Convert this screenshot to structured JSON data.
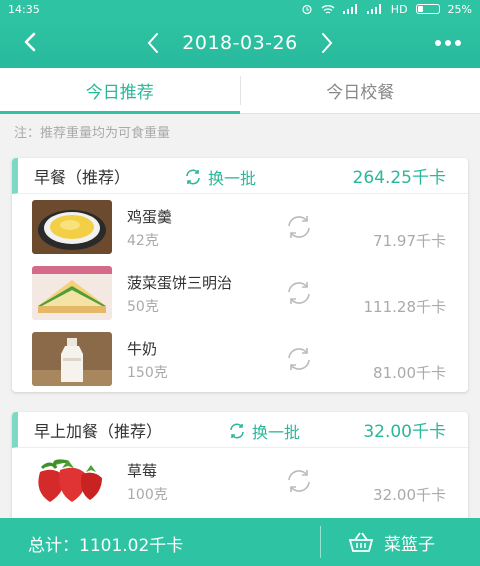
{
  "status_bar": {
    "time": "14:35",
    "network": "HD",
    "battery": "25%"
  },
  "header": {
    "date": "2018-03-26"
  },
  "tabs": [
    {
      "label": "今日推荐",
      "active": true
    },
    {
      "label": "今日校餐",
      "active": false
    }
  ],
  "note": "注：推荐重量均为可食重量",
  "meals": [
    {
      "title": "早餐（推荐）",
      "refresh_label": "换一批",
      "kcal": "264.25千卡",
      "items": [
        {
          "name": "鸡蛋羹",
          "weight": "42克",
          "kcal": "71.97千卡",
          "image": "steamed-egg"
        },
        {
          "name": "菠菜蛋饼三明治",
          "weight": "50克",
          "kcal": "111.28千卡",
          "image": "sandwich"
        },
        {
          "name": "牛奶",
          "weight": "150克",
          "kcal": "81.00千卡",
          "image": "milk-bottle"
        }
      ]
    },
    {
      "title": "早上加餐（推荐）",
      "refresh_label": "换一批",
      "kcal": "32.00千卡",
      "items": [
        {
          "name": "草莓",
          "weight": "100克",
          "kcal": "32.00千卡",
          "image": "strawberry"
        }
      ]
    }
  ],
  "footer": {
    "total": "总计：1101.02千卡",
    "basket_label": "菜篮子"
  },
  "colors": {
    "accent": "#2ec4a3",
    "accent_text": "#2ab79a",
    "muted": "#aaaaaa"
  }
}
